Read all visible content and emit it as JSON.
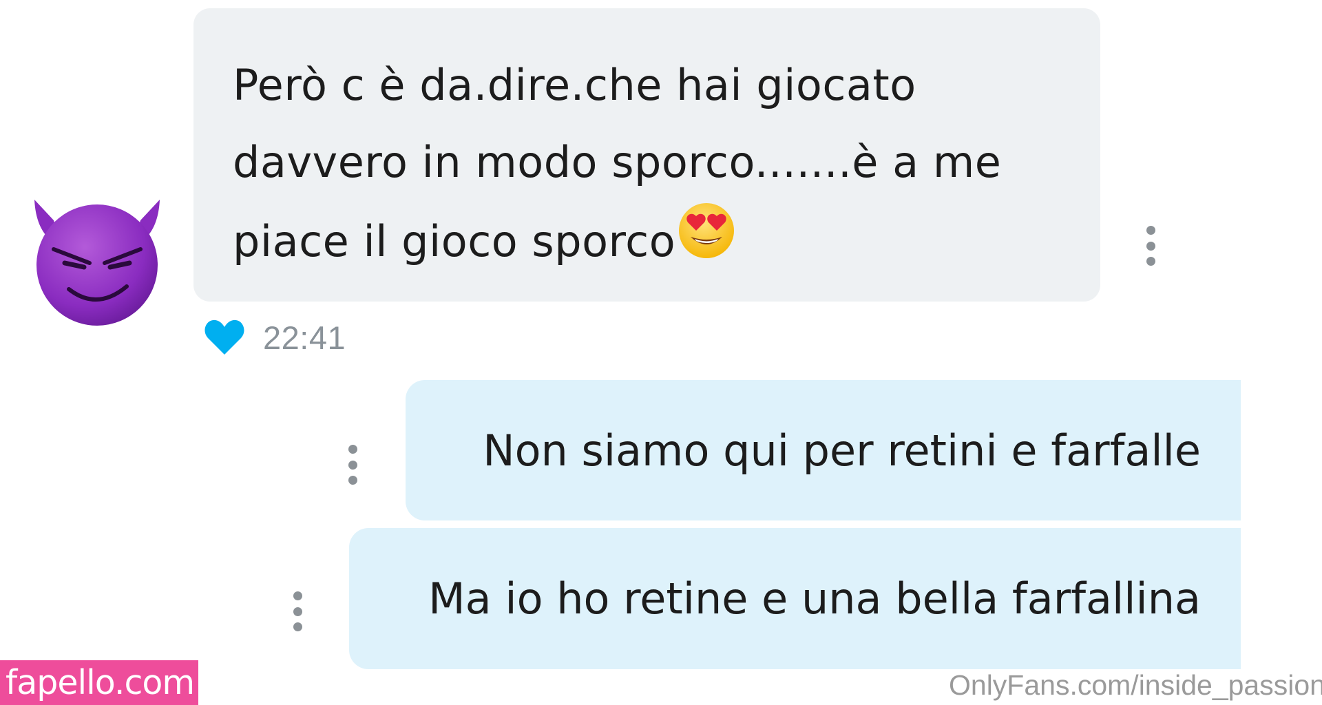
{
  "chat": {
    "incoming": {
      "lines": [
        "Però c è da.dire.che hai giocato",
        "davvero in modo sporco.......è a me",
        "piace il gioco sporco"
      ],
      "time": "22:41",
      "avatar_icon": "smiling-devil-emoji",
      "trailing_emoji_icon": "heart-eyes-emoji",
      "liked": true
    },
    "outgoing": [
      {
        "text": "Non siamo qui per retini e farfalle"
      },
      {
        "text": "Ma io ho retine e una bella farfallina"
      }
    ],
    "colors": {
      "incoming_bubble": "#eef1f3",
      "outgoing_bubble": "#def2fb",
      "heart": "#00aff0",
      "time": "#8a9299"
    }
  },
  "watermarks": {
    "left": "fapello.com",
    "right": "OnlyFans.com/inside_passion"
  }
}
